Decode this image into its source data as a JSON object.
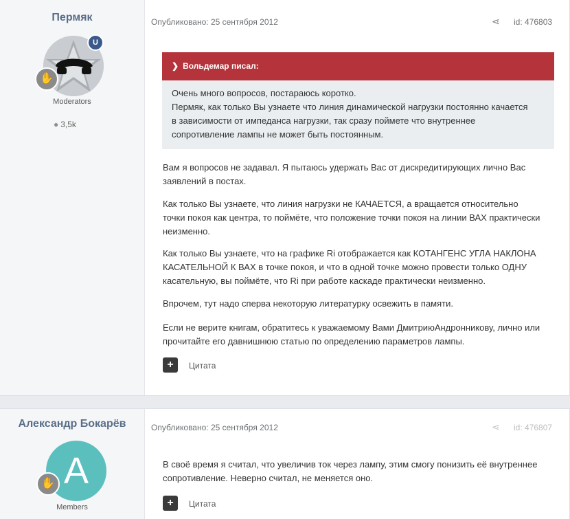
{
  "posts": [
    {
      "author": "Пермяк",
      "group": "Moderators",
      "post_count": "3,5k",
      "mod_badge": "U",
      "meta": "Опубликовано: 25 сентября 2012",
      "post_id": "id: 476803",
      "quote": {
        "header": "Вольдемар писал:",
        "lines": [
          "Очень много вопросов, постараюсь коротко.",
          "Пермяк, как только Вы узнаете что линия динамической нагрузки постоянно качается",
          "в зависимости от импеданса нагрузки, так сразу поймете что внутреннее",
          "сопротивление лампы не может быть постоянным."
        ]
      },
      "paragraphs": [
        [
          "Вам я вопросов не задавал. Я пытаюсь удержать Вас от дискредитирующих лично Вас",
          "заявлений в постах."
        ],
        [
          "Как только Вы узнаете, что линия нагрузки не КАЧАЕТСЯ, а вращается относительно",
          "точки покоя как центра, то поймёте, что положение точки покоя на линии ВАХ практически",
          "неизменно."
        ],
        [
          "Как только Вы узнаете, что на графике Ri отображается как КОТАНГЕНС УГЛА НАКЛОНА",
          "КАСАТЕЛЬНОЙ К ВАХ в точке покоя, и что в одной точке можно провести только ОДНУ",
          "касательную, вы поймёте, что Ri при работе каскаде практически неизменно."
        ],
        [
          "Впрочем, тут надо сперва некоторую литературку освежить в памяти."
        ],
        [
          "Если не верите книгам, обратитесь к уважаемому Вами ДмитриюАндронникову, лично или",
          "прочитайте его давнишнюю статью по определению параметров лампы."
        ]
      ],
      "quote_button": "Цитата"
    },
    {
      "author": "Александр Бокарёв",
      "group": "Members",
      "avatar_letter": "A",
      "meta": "Опубликовано: 25 сентября 2012",
      "post_id": "id: 476807",
      "paragraphs": [
        [
          "В своё время я считал, что увеличив ток через лампу, этим смогу понизить её внутреннее",
          "сопротивление. Неверно считал, не меняется оно."
        ]
      ],
      "quote_button": "Цитата"
    }
  ],
  "icons": {
    "share": "share-icon",
    "comment": "comment-icon",
    "plus": "plus-icon",
    "chevron": "chevron-down-icon",
    "rank": "hand-rank-icon"
  },
  "colors": {
    "quote_header": "#b5333a",
    "author_name": "#596e88",
    "avatar_members": "#5bbfbe"
  }
}
